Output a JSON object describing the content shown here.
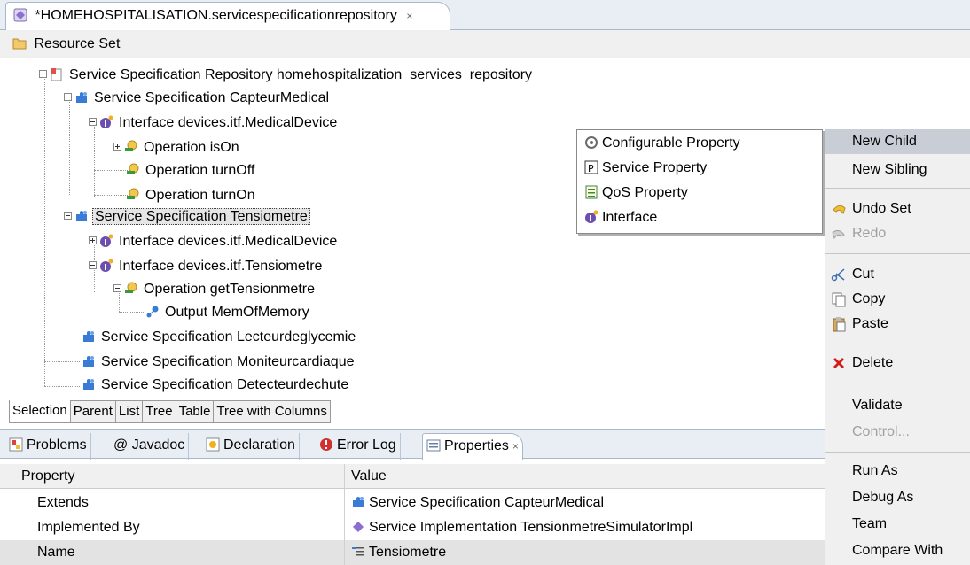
{
  "editor": {
    "tab_title": "*HOMEHOSPITALISATION.servicespecificationrepository",
    "close": "×"
  },
  "resource_set": {
    "label": "Resource Set"
  },
  "tree": {
    "repo": "Service Specification Repository homehospitalization_services_repository",
    "capteur": "Service Specification CapteurMedical",
    "itf_medical": "Interface devices.itf.MedicalDevice",
    "op_ison": "Operation isOn",
    "op_turnoff": "Operation turnOff",
    "op_turnon": "Operation turnOn",
    "tensiometre": "Service Specification Tensiometre",
    "itf_medical2": "Interface devices.itf.MedicalDevice",
    "itf_tensio": "Interface devices.itf.Tensiometre",
    "op_get": "Operation getTensionmetre",
    "output": "Output MemOfMemory",
    "lecteur": "Service Specification Lecteurdeglycemie",
    "moniteur": "Service Specification Moniteurcardiaque",
    "detecteur": "Service Specification Detecteurdechute"
  },
  "page_tabs": [
    "Selection",
    "Parent",
    "List",
    "Tree",
    "Table",
    "Tree with Columns"
  ],
  "views": {
    "problems": "Problems",
    "javadoc": "@ Javadoc",
    "declaration": "Declaration",
    "errorlog": "Error Log",
    "properties": "Properties",
    "close": "×"
  },
  "properties": {
    "col_property": "Property",
    "col_value": "Value",
    "rows": [
      {
        "key": "Extends",
        "value": "Service Specification CapteurMedical"
      },
      {
        "key": "Implemented By",
        "value": "Service Implementation TensionmetreSimulatorImpl"
      },
      {
        "key": "Name",
        "value": "Tensiometre"
      }
    ]
  },
  "child_menu": [
    "Configurable Property",
    "Service Property",
    "QoS Property",
    "Interface"
  ],
  "context_menu": {
    "new_child": "New Child",
    "new_sibling": "New Sibling",
    "undo": "Undo Set",
    "redo": "Redo",
    "cut": "Cut",
    "copy": "Copy",
    "paste": "Paste",
    "delete": "Delete",
    "validate": "Validate",
    "control": "Control...",
    "run_as": "Run As",
    "debug_as": "Debug As",
    "team": "Team",
    "compare_with": "Compare With"
  },
  "colors": {
    "accent": "#2b6fc9",
    "highlight": "#c8cdd6",
    "delete_red": "#d21b1b"
  }
}
